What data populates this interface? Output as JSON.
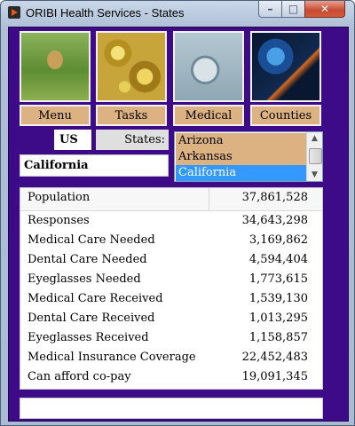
{
  "window": {
    "title": "ORIBI Health Services - States"
  },
  "title_controls": {
    "minimize": "–",
    "maximize": "□",
    "close": "✕"
  },
  "nav": [
    {
      "label": "Menu",
      "image": "gazelle-photo"
    },
    {
      "label": "Tasks",
      "image": "gold-fractal-image"
    },
    {
      "label": "Medical",
      "image": "stethoscope-globe-photo"
    },
    {
      "label": "Counties",
      "image": "burning-match-photo"
    }
  ],
  "country": "US",
  "states_label": "States:",
  "selected_state": "California",
  "state_list": {
    "items": [
      "Arizona",
      "Arkansas",
      "California"
    ],
    "selected": "California"
  },
  "stats": {
    "header": {
      "label": "Population",
      "value": "37,861,528"
    },
    "rows": [
      {
        "label": "Responses",
        "value": "34,643,298"
      },
      {
        "label": "Medical Care Needed",
        "value": "3,169,862"
      },
      {
        "label": "Dental Care Needed",
        "value": "4,594,404"
      },
      {
        "label": "Eyeglasses Needed",
        "value": "1,773,615"
      },
      {
        "label": "Medical Care Received",
        "value": "1,539,130"
      },
      {
        "label": "Dental Care Received",
        "value": "1,013,295"
      },
      {
        "label": "Eyeglasses Received",
        "value": "1,158,857"
      },
      {
        "label": "Medical Insurance Coverage",
        "value": "22,452,483"
      },
      {
        "label": "Can afford co-pay",
        "value": "19,091,345"
      }
    ]
  },
  "status_text": ""
}
